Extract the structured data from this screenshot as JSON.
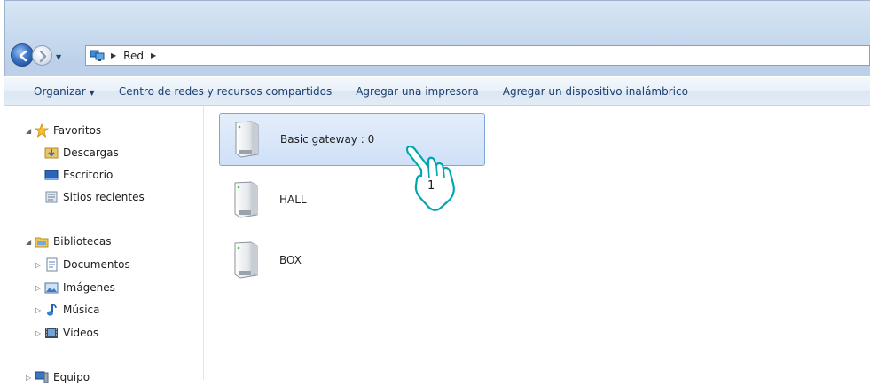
{
  "address_bar": {
    "breadcrumbs": [
      "Red"
    ]
  },
  "command_bar": {
    "items": [
      {
        "label": "Organizar",
        "has_dropdown": true
      },
      {
        "label": "Centro de redes y recursos compartidos"
      },
      {
        "label": "Agregar una impresora"
      },
      {
        "label": "Agregar un dispositivo inalámbrico"
      }
    ]
  },
  "nav_pane": {
    "favorites": {
      "label": "Favoritos",
      "items": [
        {
          "label": "Descargas",
          "icon": "downloads-folder-icon"
        },
        {
          "label": "Escritorio",
          "icon": "desktop-icon"
        },
        {
          "label": "Sitios recientes",
          "icon": "recent-places-icon"
        }
      ]
    },
    "libraries": {
      "label": "Bibliotecas",
      "items": [
        {
          "label": "Documentos",
          "icon": "documents-icon"
        },
        {
          "label": "Imágenes",
          "icon": "pictures-icon"
        },
        {
          "label": "Música",
          "icon": "music-icon"
        },
        {
          "label": "Vídeos",
          "icon": "videos-icon"
        }
      ]
    },
    "computer": {
      "label": "Equipo"
    }
  },
  "network_items": [
    {
      "label": "Basic gateway : 0",
      "selected": true
    },
    {
      "label": "HALL",
      "selected": false
    },
    {
      "label": "BOX",
      "selected": false
    }
  ],
  "annotation": {
    "step_number": "1",
    "color": "#00a6b0"
  }
}
